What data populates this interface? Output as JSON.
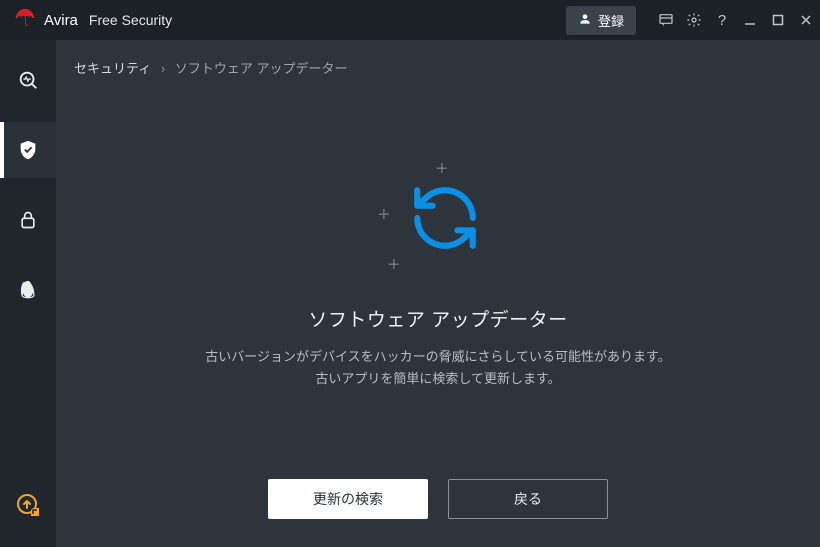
{
  "titlebar": {
    "brand": "Avira",
    "product": "Free Security",
    "register_label": "登録"
  },
  "sidebar": {
    "items": [
      {
        "name": "status",
        "active": false
      },
      {
        "name": "security",
        "active": true
      },
      {
        "name": "privacy",
        "active": false
      },
      {
        "name": "performance",
        "active": false
      }
    ],
    "bottom": {
      "name": "upgrade"
    }
  },
  "breadcrumb": {
    "root": "セキュリティ",
    "current": "ソフトウェア アップデーター"
  },
  "content": {
    "heading": "ソフトウェア アップデーター",
    "desc_line1": "古いバージョンがデバイスをハッカーの脅威にさらしている可能性があります。",
    "desc_line2": "古いアプリを簡単に検索して更新します。"
  },
  "footer": {
    "primary_label": "更新の検索",
    "secondary_label": "戻る"
  },
  "colors": {
    "accent": "#0a8fe6",
    "sidebar_bg": "#21262d",
    "main_bg": "#2d343b"
  }
}
